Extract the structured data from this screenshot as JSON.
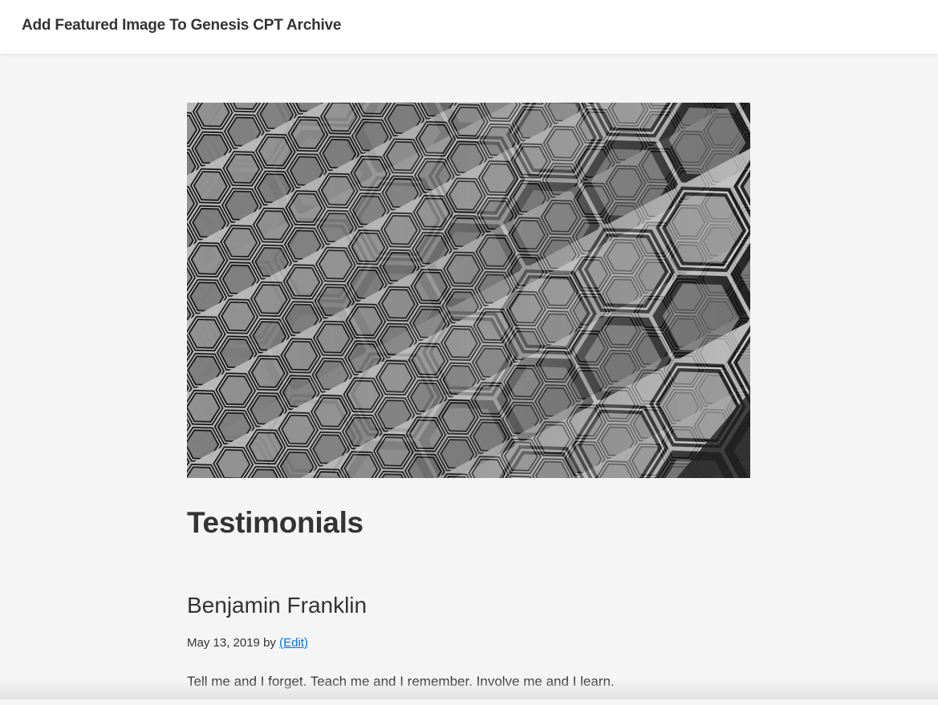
{
  "header": {
    "site_title": "Add Featured Image To Genesis CPT Archive"
  },
  "archive": {
    "title": "Testimonials",
    "featured_image_subject": "grayscale-hexagonal-glass-facade"
  },
  "entries": [
    {
      "title": "Benjamin Franklin",
      "date": "May 13, 2019",
      "by": "by",
      "edit_label": "(Edit)",
      "content": "Tell me and I forget. Teach me and I remember. Involve me and I learn."
    }
  ],
  "colors": {
    "background": "#f5f5f5",
    "header_bg": "#ffffff",
    "text": "#333333",
    "link": "#0073e5"
  }
}
